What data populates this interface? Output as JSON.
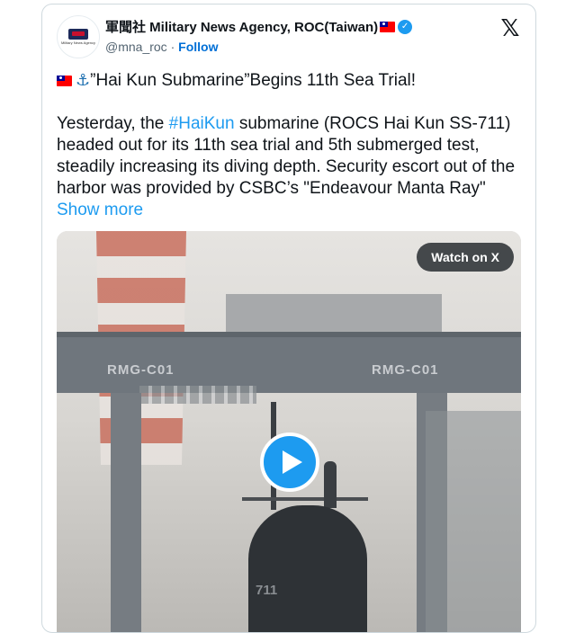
{
  "account": {
    "display_name": "軍聞社 Military News Agency, ROC(Taiwan)",
    "handle": "@mna_roc",
    "separator": "·",
    "follow_label": "Follow",
    "avatar_text": "Military News Agency"
  },
  "icons": {
    "flag": "taiwan-flag-icon",
    "verified": "verified-badge-icon",
    "x_logo": "x-logo-icon",
    "anchor": "anchor-icon",
    "play": "play-icon"
  },
  "tweet": {
    "headline": "”Hai Kun Submarine”Begins 11th Sea Trial!",
    "body_before_hashtag": "Yesterday, the ",
    "hashtag": "#HaiKun",
    "body_after_hashtag": " submarine (ROCS Hai Kun SS-711) headed out for its 11th sea trial and 5th submerged test, steadily increasing its diving depth. Security escort out of the harbor was provided by CSBC’s \"Endeavour Manta Ray\" ",
    "show_more_label": "Show more"
  },
  "media": {
    "watch_label": "Watch on X",
    "gantry_label_left": "RMG-C01",
    "gantry_label_right": "RMG-C01",
    "sail_number": "711"
  },
  "colors": {
    "link": "#1d9bf0",
    "follow": "#006fd6",
    "verified": "#1d9bf0",
    "play_button": "#1d9bf0"
  }
}
